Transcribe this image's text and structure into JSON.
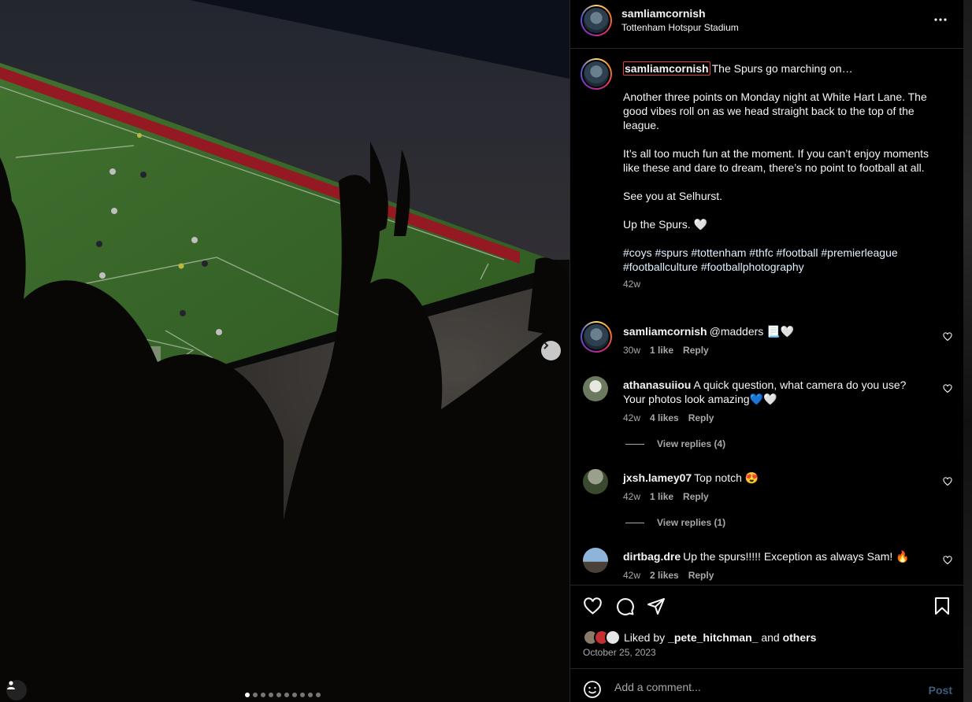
{
  "post": {
    "username": "samliamcornish",
    "location": "Tottenham Hotspur Stadium",
    "carousel": {
      "slide_count": 10,
      "active_slide": 1
    }
  },
  "caption": {
    "username": "samliamcornish",
    "title": "The Spurs go marching on…",
    "paragraphs": [
      "Another three points on Monday night at White Hart Lane. The good vibes roll on as we head straight back to the top of the league.",
      "It’s all too much fun at the moment. If you can’t enjoy moments like these and dare to dream, there’s no point to football at all.",
      "See you at Selhurst.",
      "Up the Spurs. 🤍"
    ],
    "hashtags": "#coys #spurs #tottenham #thfc #football #premierleague #footballculture #footballphotography",
    "time": "42w"
  },
  "comments": [
    {
      "username": "samliamcornish",
      "text": "@madders 📃🤍",
      "time": "30w",
      "likes": "1 like",
      "reply": "Reply"
    },
    {
      "username": "athanasuiiou",
      "text": "A quick question, what camera do you use? Your photos look amazing💙🤍",
      "time": "42w",
      "likes": "4 likes",
      "reply": "Reply",
      "view_replies": "View replies (4)"
    },
    {
      "username": "jxsh.lamey07",
      "text": "Top notch 😍",
      "time": "42w",
      "likes": "1 like",
      "reply": "Reply",
      "view_replies": "View replies (1)"
    },
    {
      "username": "dirtbag.dre",
      "text": "Up the spurs!!!!! Exception as always Sam! 🔥",
      "time": "42w",
      "likes": "2 likes",
      "reply": "Reply"
    }
  ],
  "likes": {
    "prefix": "Liked by",
    "first_user": "_pete_hitchman_",
    "joiner": "and",
    "others": "others"
  },
  "date": "October 25, 2023",
  "add_comment": {
    "placeholder": "Add a comment...",
    "post_label": "Post"
  },
  "icons": {
    "heart": "heart-icon",
    "comment": "comment-icon",
    "share": "send-icon",
    "save": "bookmark-icon",
    "more": "more-icon",
    "emoji": "emoji-icon",
    "next": "chevron-right-icon",
    "tag": "user-tag-icon"
  },
  "colors": {
    "accent_link": "#e0f1ff",
    "post_disabled": "#3a5f7f",
    "secondary_text": "#a8a8a8"
  }
}
